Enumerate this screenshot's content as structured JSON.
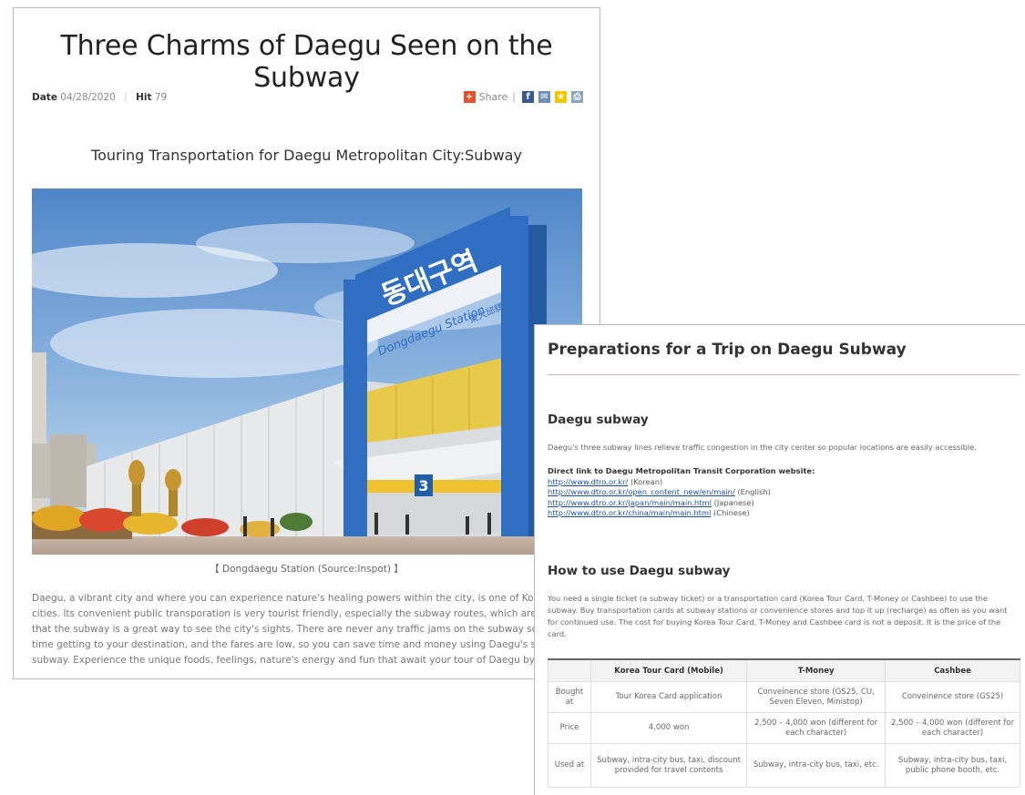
{
  "article": {
    "title": "Three Charms of Daegu Seen on the Subway",
    "date_label": "Date",
    "date": "04/28/2020",
    "hit_label": "Hit",
    "hit": "79",
    "share_label": "Share",
    "subtitle": "Touring Transportation for Daegu Metropolitan City:Subway",
    "photo_sign_korean": "동대구역",
    "photo_sign_english": "Dongdaegu Station",
    "photo_sign_chinese": "東大邱驛",
    "photo_platform_number": "3",
    "caption": "【 Dongdaegu Station (Source:Inspot) 】",
    "body_lines": [
      "Daegu, a vibrant city and where you can experience nature's healing powers within the city, is one of Korea's m",
      "cities. Its convenient public transporation is very tourist friendly, especially the subway routes, which are so we",
      "that the subway is a great way to see the city's sights. There are never any traffic jams on the subway so you c",
      "time getting to your destination, and the fares are low, so you can save time and money using Daegu's safe, co",
      "subway. Experience the unique foods, feelings, nature's energy and fun that await your tour of Daegu by subwa"
    ]
  },
  "guide": {
    "title": "Preparations for a Trip on Daegu Subway",
    "section1_heading": "Daegu subway",
    "section1_text": "Daegu's three subway lines relieve traffic congestion in the city center so popular locations are easily accessible.",
    "links_heading": "Direct link to Daegu Metropolitan Transit Corporation website:",
    "links": [
      {
        "url": "http://www.dtro.or.kr/",
        "lang": "(Korean)"
      },
      {
        "url": "http://www.dtro.or.kr/open_content_new/en/main/",
        "lang": "(English)"
      },
      {
        "url": "http://www.dtro.or.kr/japan/main/main.html",
        "lang": "(Japanese)"
      },
      {
        "url": "http://www.dtro.or.kr/china/main/main.html",
        "lang": "(Chinese)"
      }
    ],
    "section2_heading": "How to use Daegu subway",
    "section2_text": "You need a single ticket (a subway ticket) or a transportation card (Korea Tour Card, T-Money or Cashbee) to use the subway. Buy transportation cards at subway stations or convenience stores and top it up (recharge) as often as you want for continued use. The cost for buying Korea Tour Card, T-Money and Cashbee card is not a deposit. It is the price of the card.",
    "table": {
      "headers": [
        "",
        "Korea Tour Card (Mobile)",
        "T-Money",
        "Cashbee"
      ],
      "rows": [
        [
          "Bought at",
          "Tour Korea Card application",
          "Conveinence store (GS25, CU, Seven Eleven, Ministop)",
          "Conveinence store (GS25)"
        ],
        [
          "Price",
          "4,000 won",
          "2,500 – 4,000 won (different for each character)",
          "2,500 – 4,000 won (different for each character)"
        ],
        [
          "Used at",
          "Subway, intra-city bus, taxi, discount provided for travel contents",
          "Subway, intra-city bus, taxi, etc.",
          "Subway, intra-city bus, taxi, public phone booth, etc."
        ]
      ]
    }
  }
}
